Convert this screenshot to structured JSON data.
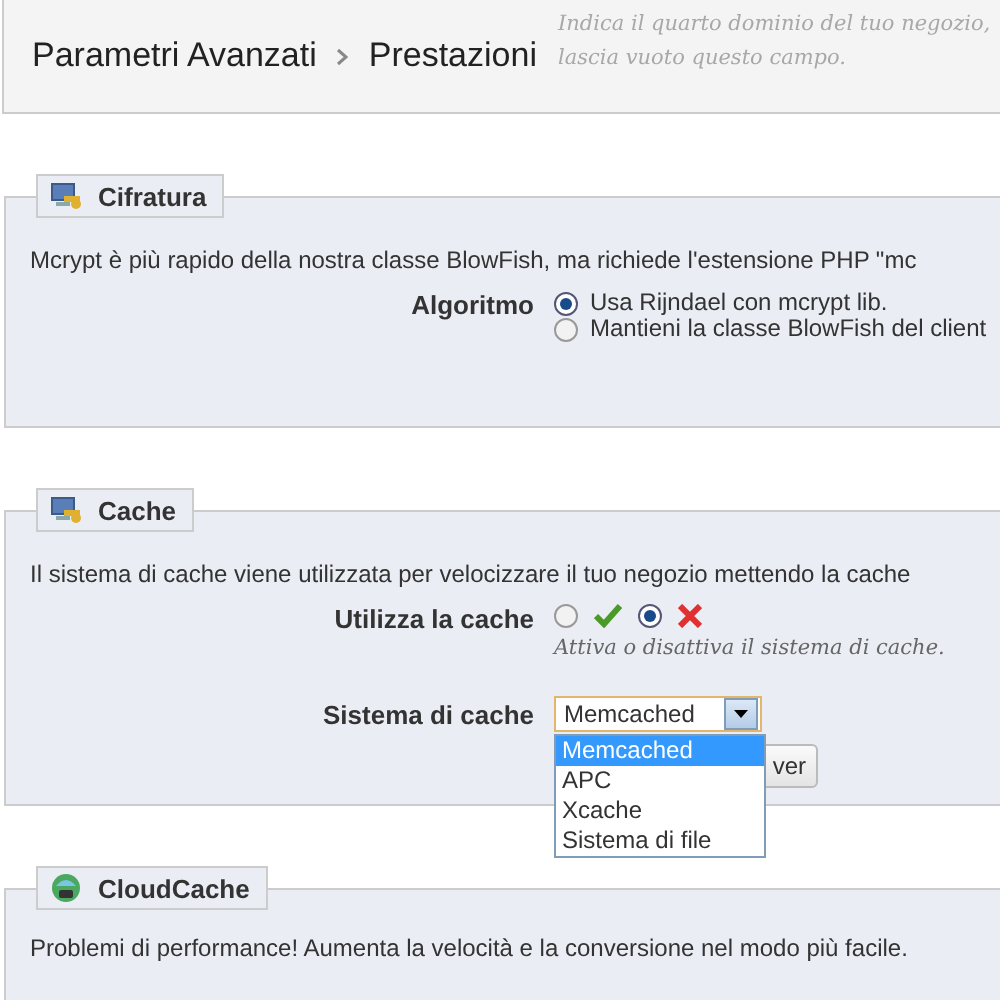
{
  "header": {
    "breadcrumb": [
      "Parametri Avanzati",
      "Prestazioni"
    ],
    "ghost_hint": [
      "Indica il quarto dominio del tuo negozio,",
      "lascia vuoto questo campo."
    ]
  },
  "sections": [
    {
      "kind": "encryption",
      "title": "Cifratura",
      "description": "Mcrypt è più rapido della nostra classe BlowFish, ma richiede l'estensione PHP \"mc",
      "field": {
        "label": "Algoritmo",
        "options": [
          {
            "label": "Usa Rijndael con mcrypt lib.",
            "selected": true
          },
          {
            "label": "Mantieni la classe BlowFish del client",
            "selected": false
          }
        ]
      }
    },
    {
      "kind": "cache",
      "title": "Cache",
      "description": "Il sistema di cache viene utilizzata per velocizzare il tuo negozio mettendo la cache",
      "toggle": {
        "label": "Utilizza la cache",
        "options": [
          {
            "kind": "yes",
            "selected": false
          },
          {
            "kind": "no",
            "selected": true
          }
        ],
        "hint": "Attiva o disattiva il sistema di cache."
      },
      "select": {
        "label": "Sistema di cache",
        "value": "Memcached",
        "expanded": true,
        "options": [
          {
            "label": "Memcached",
            "selected": true
          },
          {
            "label": "APC",
            "selected": false
          },
          {
            "label": "Xcache",
            "selected": false
          },
          {
            "label": "Sistema di file",
            "selected": false
          }
        ]
      },
      "button": "ver"
    },
    {
      "kind": "cloud",
      "title": "CloudCache",
      "description": "Problemi di performance! Aumenta la velocità e la conversione nel modo più facile."
    }
  ]
}
